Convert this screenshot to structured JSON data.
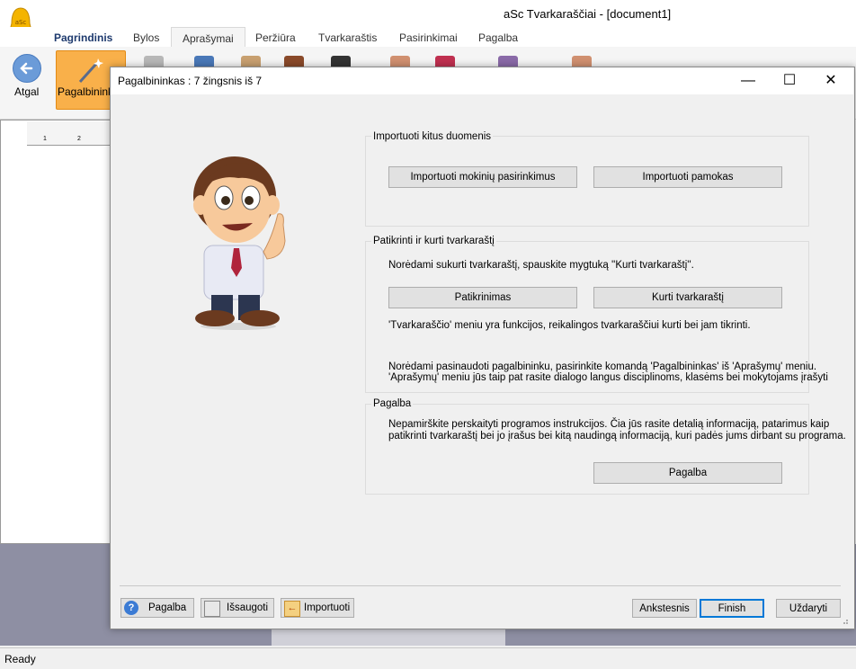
{
  "app": {
    "title": "aSc Tvarkaraščiai - [document1]",
    "logo_text": "aSc"
  },
  "menu": {
    "tabs": [
      "Pagrindinis",
      "Bylos",
      "Aprašymai",
      "Peržiūra",
      "Tvarkaraštis",
      "Pasirinkimai",
      "Pagalba"
    ]
  },
  "ribbon": {
    "back_label": "Atgal",
    "wizard_label": "Pagalbininka"
  },
  "grid": {
    "col1": "1",
    "col2": "2"
  },
  "status": {
    "text": "Ready"
  },
  "dialog": {
    "title": "Pagalbininkas : 7 žingsnis iš 7",
    "import_group": {
      "title": "Importuoti kitus duomenis",
      "btn_import_choices": "Importuoti mokinių pasirinkimus",
      "btn_import_lessons": "Importuoti pamokas"
    },
    "check_group": {
      "title": "Patikrinti ir kurti tvarkaraštį",
      "instruction": "Norėdami sukurti tvarkaraštį, spauskite mygtuką ''Kurti tvarkaraštį''.",
      "btn_check": "Patikrinimas",
      "btn_create": "Kurti tvarkaraštį",
      "menu_note": "'Tvarkaraščio' meniu yra funkcijos, reikalingos tvarkaraščiui kurti bei jam tikrinti.",
      "wizard_note_1": "Norėdami pasinaudoti pagalbininku, pasirinkite komandą 'Pagalbininkas' iš 'Aprašymų' meniu.",
      "wizard_note_2": "'Aprašymų' meniu jūs taip pat rasite dialogo langus disciplinoms, klasėms bei mokytojams įrašyti"
    },
    "help_group": {
      "title": "Pagalba",
      "text_1": "Nepamirškite perskaityti programos instrukcijos. Čia jūs rasite detalią informaciją, patarimus kaip",
      "text_2": "patikrinti tvarkaraštį bei jo įrašus bei kitą naudingą informaciją, kuri padės jums dirbant su programa.",
      "btn_help": "Pagalba"
    },
    "footer": {
      "btn_help": "Pagalba",
      "btn_save": "Išsaugoti",
      "btn_import": "Importuoti",
      "btn_back": "Ankstesnis",
      "btn_finish": "Finish",
      "btn_close": "Uždaryti"
    },
    "controls": {
      "minimize": "—",
      "maximize": "☐",
      "close": "✕"
    }
  },
  "colors": {
    "accent": "#0078d7",
    "wizard_button": "#f9b04a",
    "menu_bold": "#1e3a6e"
  }
}
